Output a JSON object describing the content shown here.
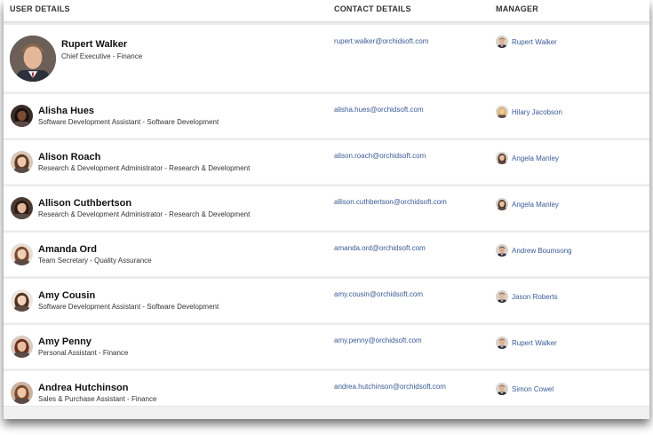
{
  "columns": {
    "user": "USER DETAILS",
    "contact": "CONTACT DETAILS",
    "manager": "MANAGER"
  },
  "colors": {
    "link": "#3a5a96",
    "divider": "#e2e2e2"
  },
  "users": [
    {
      "name": "Rupert Walker",
      "role": "Chief Executive - Finance",
      "email": "rupert.walker@orchidsoft.com",
      "manager": "Rupert Walker",
      "avatar_icon": "person-photo-icon",
      "skin": "#e5b79a",
      "hair": "#8a6a4a",
      "bg": "#6b5f57",
      "mgr_skin": "#e0b08f",
      "mgr_hair": "#7a5a3a"
    },
    {
      "name": "Alisha Hues",
      "role": "Software Development Assistant - Software Development",
      "email": "alisha.hues@orchidsoft.com",
      "manager": "Hilary Jacobson",
      "avatar_icon": "person-photo-icon",
      "skin": "#7a4b35",
      "hair": "#1a1210",
      "bg": "#3b2c26",
      "mgr_skin": "#f0c8a0",
      "mgr_hair": "#d9b25a"
    },
    {
      "name": "Alison Roach",
      "role": "Research & Development Administrator - Research & Development",
      "email": "alison.roach@orchidsoft.com",
      "manager": "Angela Manley",
      "avatar_icon": "person-photo-icon",
      "skin": "#edc8ad",
      "hair": "#5b3a23",
      "bg": "#d8c7b8",
      "mgr_skin": "#e7c0a5",
      "mgr_hair": "#4a3222"
    },
    {
      "name": "Allison Cuthbertson",
      "role": "Research & Development Administrator - Research & Development",
      "email": "allison.cuthbertson@orchidsoft.com",
      "manager": "Angela Manley",
      "avatar_icon": "person-photo-icon",
      "skin": "#e3b79c",
      "hair": "#2b1c14",
      "bg": "#4a3a30",
      "mgr_skin": "#e7c0a5",
      "mgr_hair": "#4a3222"
    },
    {
      "name": "Amanda Ord",
      "role": "Team Secretary - Quality Assurance",
      "email": "amanda.ord@orchidsoft.com",
      "manager": "Andrew Boumsong",
      "avatar_icon": "person-photo-icon",
      "skin": "#f0cfb5",
      "hair": "#7b4a2c",
      "bg": "#e9ded4",
      "mgr_skin": "#d9a889",
      "mgr_hair": "#3a2a1e"
    },
    {
      "name": "Amy Cousin",
      "role": "Software Development Assistant - Software Development",
      "email": "amy.cousin@orchidsoft.com",
      "manager": "Jason Roberts",
      "avatar_icon": "person-photo-icon",
      "skin": "#f2d2bb",
      "hair": "#4e3322",
      "bg": "#efe7df",
      "mgr_skin": "#e2b999",
      "mgr_hair": "#5b4232"
    },
    {
      "name": "Amy Penny",
      "role": "Personal Assistant - Finance",
      "email": "amy.penny@orchidsoft.com",
      "manager": "Rupert Walker",
      "avatar_icon": "person-photo-icon",
      "skin": "#e8bea3",
      "hair": "#6a2f1f",
      "bg": "#d9cbc0",
      "mgr_skin": "#e0b08f",
      "mgr_hair": "#7a5a3a"
    },
    {
      "name": "Andrea Hutchinson",
      "role": "Sales & Purchase Assistant - Finance",
      "email": "andrea.hutchinson@orchidsoft.com",
      "manager": "Simon Cowel",
      "avatar_icon": "person-photo-icon",
      "skin": "#efc6a7",
      "hair": "#7e4a28",
      "bg": "#c9b3a0",
      "mgr_skin": "#dcb08f",
      "mgr_hair": "#6b5847"
    }
  ]
}
